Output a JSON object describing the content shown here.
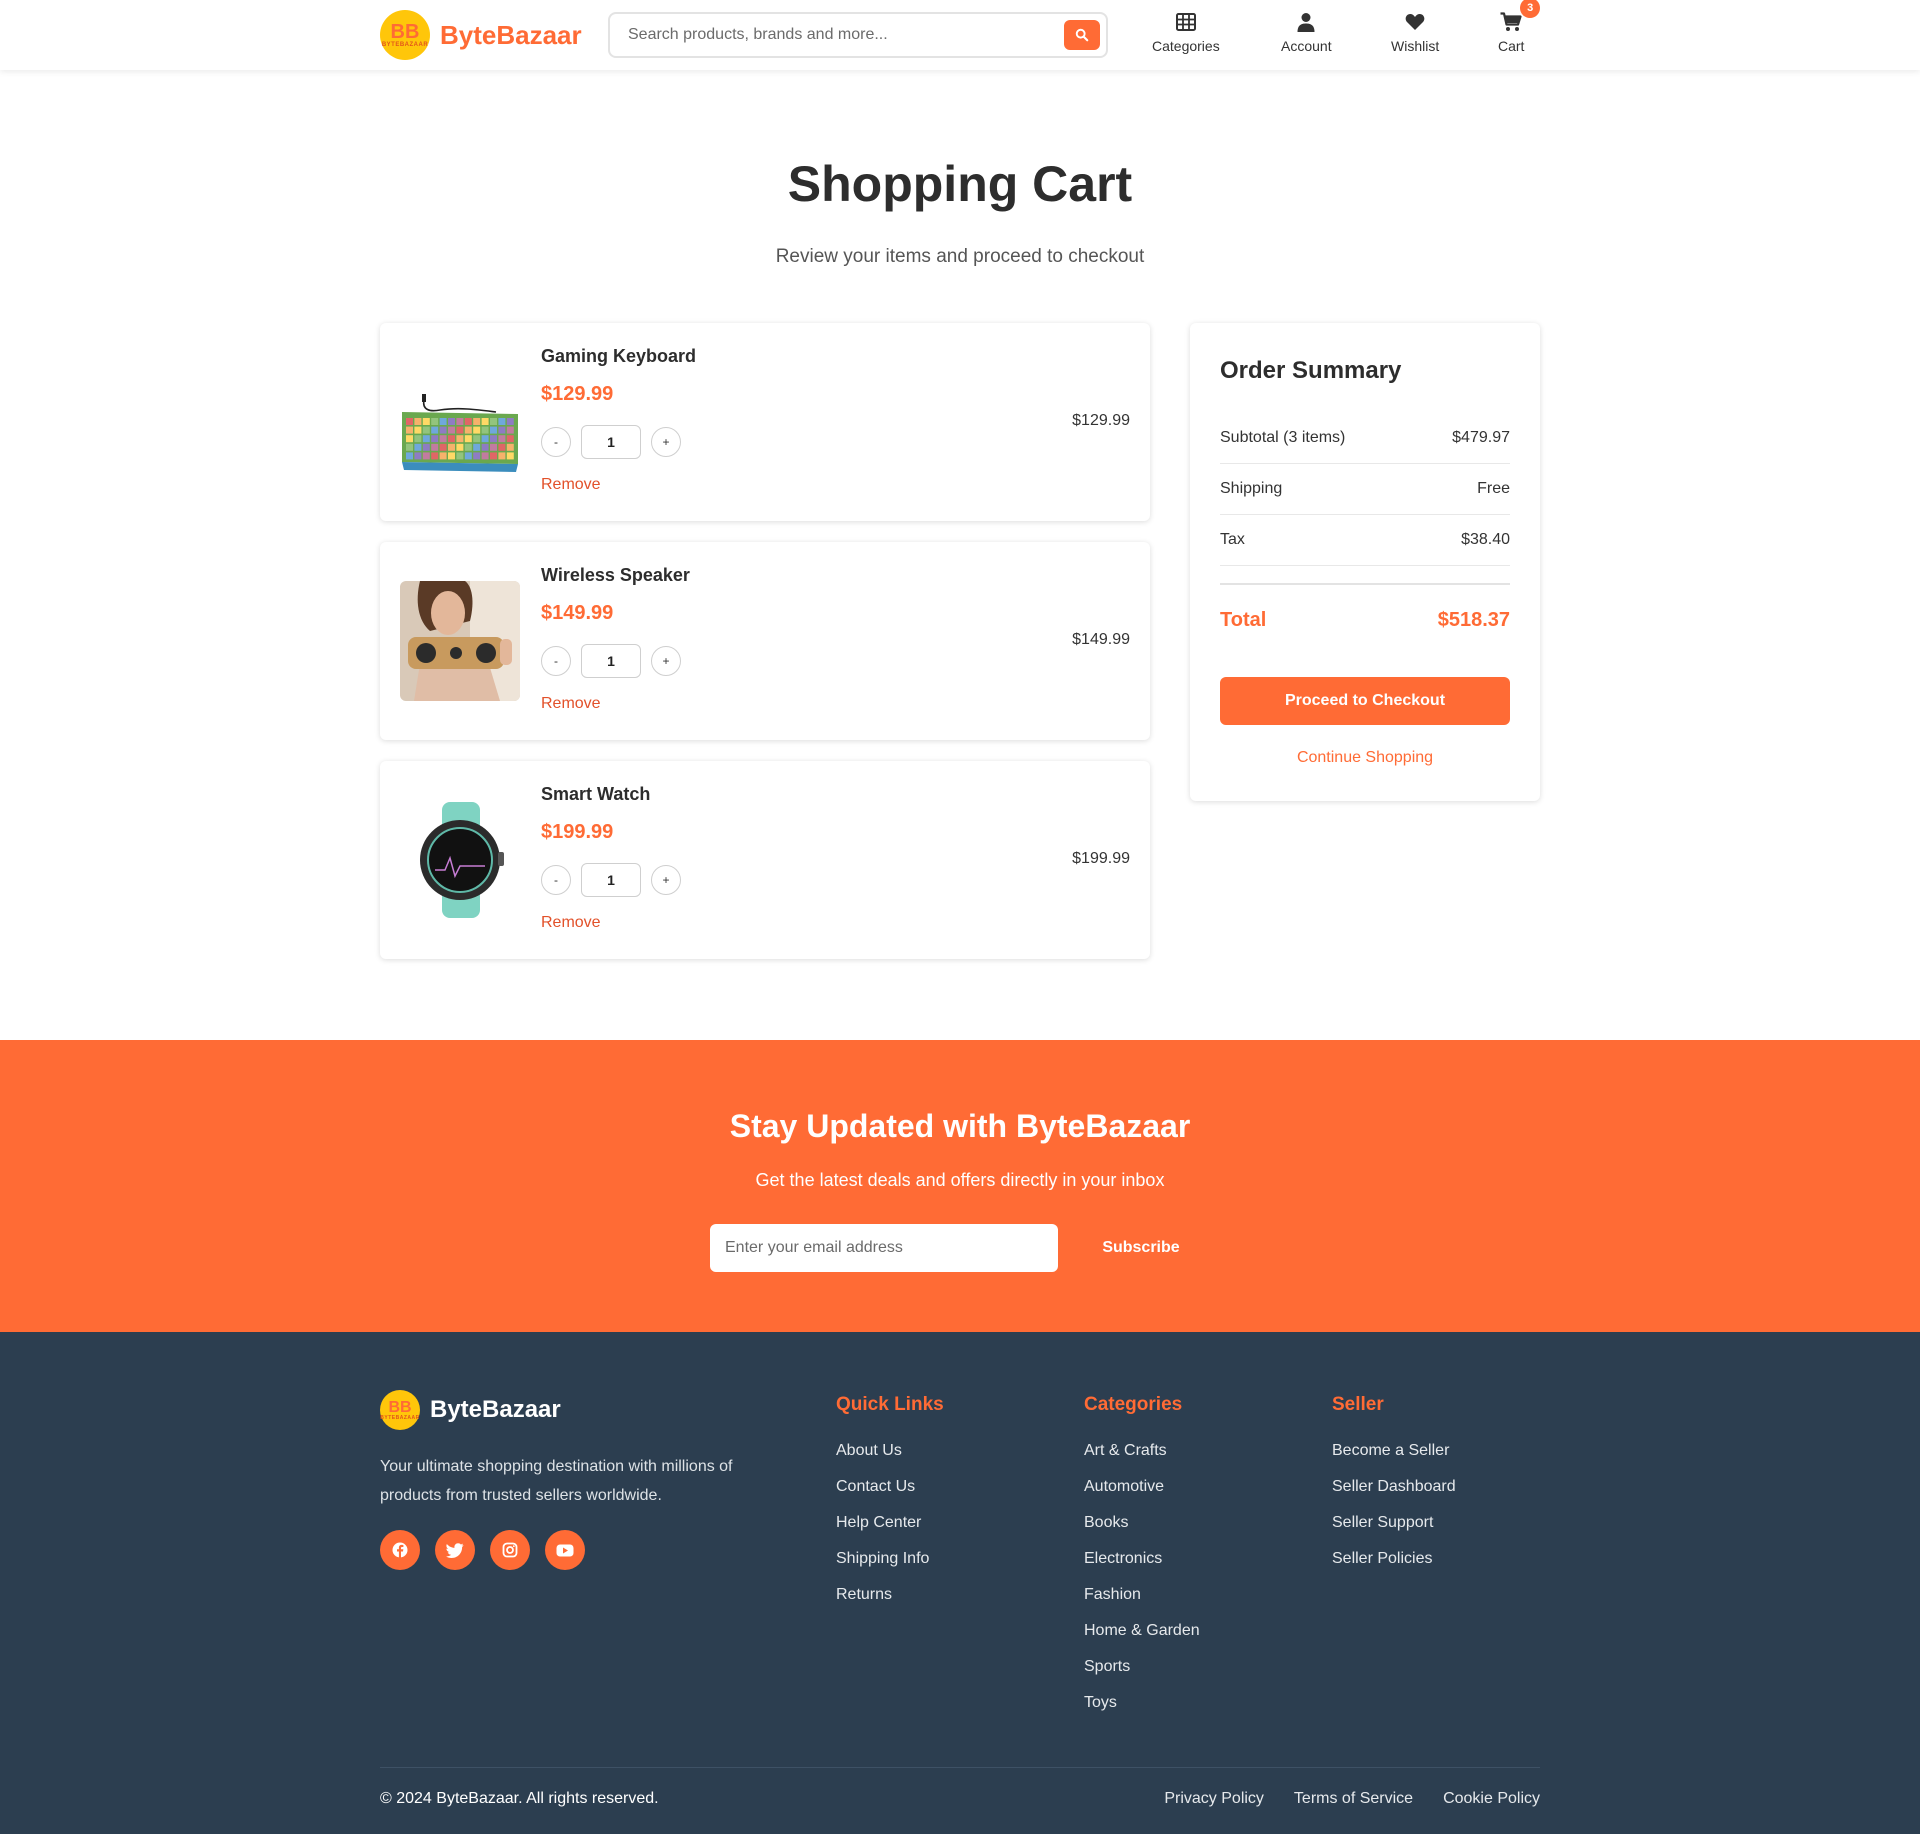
{
  "header": {
    "logo_text": "ByteBazaar",
    "logo_mark": "BB",
    "logo_small": "BYTEBAZAAR",
    "search_placeholder": "Search products, brands and more...",
    "nav": {
      "categories": "Categories",
      "account": "Account",
      "wishlist": "Wishlist",
      "cart": "Cart"
    },
    "cart_count": "3"
  },
  "page": {
    "title": "Shopping Cart",
    "subtitle": "Review your items and proceed to checkout"
  },
  "cart": {
    "items": [
      {
        "name": "Gaming Keyboard",
        "price": "$129.99",
        "quantity": "1",
        "line_total": "$129.99",
        "remove_label": "Remove",
        "image": "keyboard-image",
        "decrease": "-",
        "increase": "+"
      },
      {
        "name": "Wireless Speaker",
        "price": "$149.99",
        "quantity": "1",
        "line_total": "$149.99",
        "remove_label": "Remove",
        "image": "speaker-image",
        "decrease": "-",
        "increase": "+"
      },
      {
        "name": "Smart Watch",
        "price": "$199.99",
        "quantity": "1",
        "line_total": "$199.99",
        "remove_label": "Remove",
        "image": "watch-image",
        "decrease": "-",
        "increase": "+"
      }
    ]
  },
  "summary": {
    "title": "Order Summary",
    "subtotal_label": "Subtotal (3 items)",
    "subtotal_value": "$479.97",
    "shipping_label": "Shipping",
    "shipping_value": "Free",
    "tax_label": "Tax",
    "tax_value": "$38.40",
    "total_label": "Total",
    "total_value": "$518.37",
    "checkout_label": "Proceed to Checkout",
    "continue_label": "Continue Shopping"
  },
  "newsletter": {
    "title": "Stay Updated with ByteBazaar",
    "subtitle": "Get the latest deals and offers directly in your inbox",
    "placeholder": "Enter your email address",
    "button": "Subscribe"
  },
  "footer": {
    "brand": "ByteBazaar",
    "description": "Your ultimate shopping destination with millions of products from trusted sellers worldwide.",
    "socials": [
      "facebook-icon",
      "twitter-icon",
      "instagram-icon",
      "youtube-icon"
    ],
    "quick_links": {
      "title": "Quick Links",
      "items": [
        "About Us",
        "Contact Us",
        "Help Center",
        "Shipping Info",
        "Returns"
      ]
    },
    "categories": {
      "title": "Categories",
      "items": [
        "Art & Crafts",
        "Automotive",
        "Books",
        "Electronics",
        "Fashion",
        "Home & Garden",
        "Sports",
        "Toys"
      ]
    },
    "seller": {
      "title": "Seller",
      "items": [
        "Become a Seller",
        "Seller Dashboard",
        "Seller Support",
        "Seller Policies"
      ]
    },
    "copyright": "© 2024 ByteBazaar. All rights reserved.",
    "legal": [
      "Privacy Policy",
      "Terms of Service",
      "Cookie Policy"
    ]
  },
  "colors": {
    "accent": "#ff6b35",
    "logo_yellow": "#ffc60a",
    "footer_bg": "#2c3e50",
    "remove_red": "#e2512a"
  }
}
